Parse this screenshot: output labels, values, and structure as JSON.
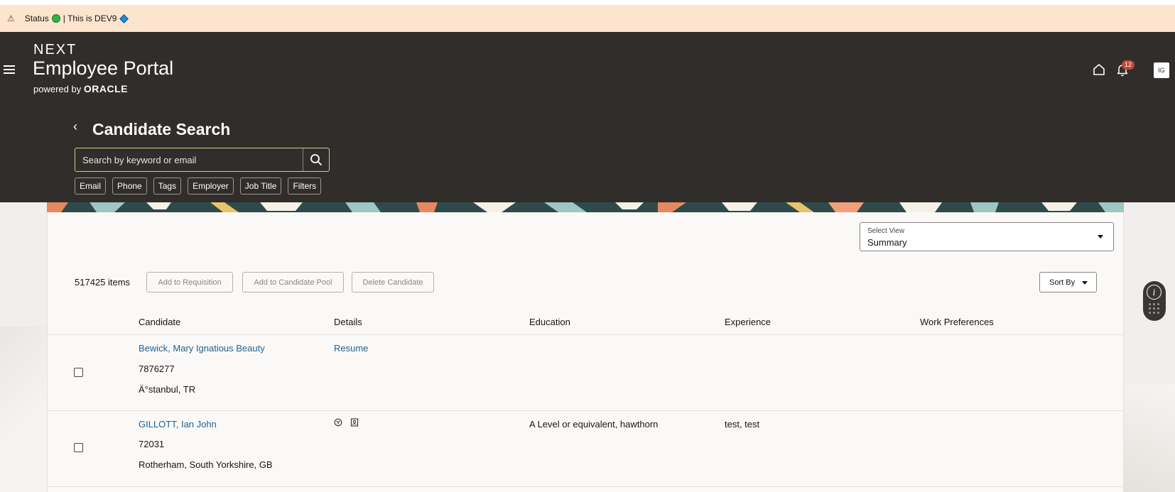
{
  "status_bar": {
    "warning_icon": "⚠",
    "status_label": "Status",
    "env_text": "| This is DEV9"
  },
  "header": {
    "brand_next": "NEXT",
    "brand_portal": "Employee Portal",
    "powered_by": "powered by",
    "oracle": "ORACLE",
    "notification_count": "12",
    "avatar_initials": "IG"
  },
  "page": {
    "title": "Candidate Search"
  },
  "search": {
    "placeholder": "Search by keyword or email"
  },
  "chips": [
    "Email",
    "Phone",
    "Tags",
    "Employer",
    "Job Title",
    "Filters"
  ],
  "view_select": {
    "label": "Select View",
    "value": "Summary"
  },
  "toolbar": {
    "items_count": "517425 items",
    "add_to_requisition": "Add to Requisition",
    "add_to_pool": "Add to Candidate Pool",
    "delete_candidate": "Delete Candidate",
    "sort_by": "Sort By"
  },
  "columns": [
    "Candidate",
    "Details",
    "Education",
    "Experience",
    "Work Preferences"
  ],
  "rows": [
    {
      "name": "Bewick, Mary Ignatious Beauty",
      "id": "7876277",
      "location": "Ä°stanbul, TR",
      "details_link": "Resume",
      "education": "",
      "experience": ""
    },
    {
      "name": "GILLOTT, Ian John",
      "id": "72031",
      "location": "Rotherham, South Yorkshire, GB",
      "details_link": "",
      "education": "A Level or equivalent, hawthorn",
      "experience": "test, test"
    }
  ],
  "colors": {
    "header_bg": "#312d2a",
    "status_bg": "#fce4cf",
    "link": "#22618e",
    "badge": "#c74634"
  }
}
